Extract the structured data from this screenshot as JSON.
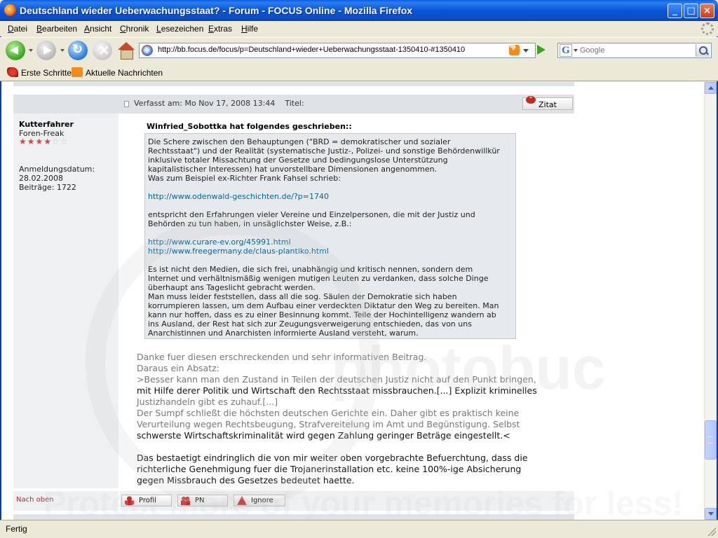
{
  "window": {
    "title": "Deutschland wieder Ueberwachungsstaat? - Forum - FOCUS Online - Mozilla Firefox",
    "minimize": "_",
    "maximize": "□",
    "close": "×"
  },
  "menu": {
    "items": [
      "Datei",
      "Bearbeiten",
      "Ansicht",
      "Chronik",
      "Lesezeichen",
      "Extras",
      "Hilfe"
    ]
  },
  "navigation": {
    "url": "http://bb.focus.de/focus/p=Deutschland+wieder+Ueberwachungsstaat-1350410-#1350410",
    "search_placeholder": "Google",
    "search_engine_icon": "G"
  },
  "bookmarks": {
    "items": [
      "Erste Schritte",
      "Aktuelle Nachrichten"
    ]
  },
  "post": {
    "posted_label": "Verfasst am: Mo Nov 17, 2008 13:44",
    "title_label": "Titel:",
    "quote_button": "Zitat",
    "author": {
      "name": "Kutterfahrer",
      "rank": "Foren-Freak",
      "stars_filled": 4,
      "stars_total": 6,
      "stars_on": "★★★★",
      "stars_off": "☆☆",
      "registered_label": "Anmeldungsdatum:",
      "registered_date": "28.02.2008",
      "posts_label": "Beiträge: 1722"
    },
    "quote": {
      "header": "Winfried_Sobottka hat folgendes geschrieben::",
      "lines": [
        "Die Schere zwischen den Behauptungen (\"BRD = demokratischer und sozialer",
        "Rechtsstaat\") und der Realität (systematische Justiz-, Polizei- und sonstige Behördenwillkür",
        "inklusive totaler Missachtung der Gesetze und bedingungslose Unterstützung",
        "kapitalistischer Interessen) hat unvorstellbare Dimensionen angenommen.",
        "Was zum Beispiel ex-Richter Frank Fahsel schrieb:"
      ],
      "link1": "http://www.odenwald-geschichten.de/?p=1740",
      "lines2": [
        "entspricht den Erfahrungen vieler Vereine und Einzelpersonen, die mit der Justiz und",
        "Behörden zu tun haben, in unsäglichster Weise, z.B.:"
      ],
      "link2": "http://www.curare-ev.org/45991.html",
      "link3": "http://www.freegermany.de/claus-plantiko.html",
      "lines3": [
        "Es ist nicht den Medien, die sich frei, unabhängig und kritisch nennen, sondern dem",
        "Internet und verhältnismäßig wenigen mutigen Leuten zu verdanken, dass solche Dinge",
        "überhaupt ans Tageslicht gebracht werden.",
        "Man muss leider feststellen, dass all die sog. Säulen der Demokratie sich haben",
        "korrumpieren lassen, um dem Aufbau einer verdeckten Diktatur den Weg zu bereiten. Man",
        "kann nur hoffen, dass es zu einer Besinnung kommt. Teile der Hochintelligenz wandern ab",
        "ins Ausland, der Rest hat sich zur Zeugungsverweigerung entschieden, das von uns",
        "Anarchistinnen und Anarchisten informierte Ausland versteht, warum."
      ]
    },
    "reply_lines": [
      "Danke fuer diesen erschreckenden und sehr informativen Beitrag.",
      "Daraus ein Absatz:",
      ">Besser kann man den Zustand in Teilen der deutschen Justiz nicht auf den Punkt bringen,",
      "mit Hilfe derer Politik und Wirtschaft den Rechtsstaat missbrauchen.[...] Explizit kriminelles",
      "Justizhandeln gibt es zuhauf.[...]",
      "Der Sumpf schließt die höchsten deutschen Gerichte ein. Daher gibt es praktisch keine",
      "Verurteilung wegen Rechtsbeugung, Strafvereitelung im Amt und Begünstigung. Selbst",
      "schwerste Wirtschaftskriminalität wird gegen Zahlung geringer Beträge eingestellt.<"
    ],
    "reply_lines2": [
      "Das bestaetigt eindringlich die von mir weiter oben vorgebrachte Befuerchtung, dass die",
      "richterliche Genehmigung fuer die Trojanerinstallation etc. keine 100%-ige Absicherung",
      "gegen Missbrauch des Gesetzes bedeutet haette."
    ]
  },
  "footer": {
    "back_to_top": "Nach oben",
    "profile_button": "Profil",
    "pm_button": "PN",
    "ignore_button": "Ignore"
  },
  "watermark": {
    "text": "photobuc",
    "text2": "Protect more of your memories for less!"
  },
  "status": {
    "text": "Fertig"
  }
}
